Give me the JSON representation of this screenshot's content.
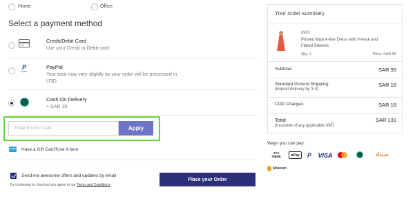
{
  "address_types": {
    "home": "Home",
    "office": "Office"
  },
  "section_title": "Select a payment method",
  "payment_methods": [
    {
      "title": "Credit/Debit Card",
      "subtitle": "Use your Credit or Debit card"
    },
    {
      "title": "PayPal",
      "subtitle_line1": "Your total may vary slightly as your order will be processed in",
      "subtitle_line2": "USD."
    },
    {
      "title": "Cash On Delivery",
      "subtitle": "+ SAR 18"
    }
  ],
  "promo": {
    "placeholder": "Enter Promo Code",
    "apply_label": "Apply"
  },
  "gift_card": {
    "text": "Have a Gift Card?",
    "link": "Use it here"
  },
  "newsletter": {
    "label": "Send me awesome offers and updates by email"
  },
  "terms": {
    "prefix": "By continuing to checkout you agree to our",
    "link": "Terms and Conditions"
  },
  "place_order_label": "Place your Order",
  "summary": {
    "title": "Your order summary",
    "item": {
      "brand": "MAX",
      "name_line1": "Printed Maxi A-line Dress with V-neck and",
      "name_line2": "Flared Sleeves",
      "qty": "Qty: 1",
      "price": "Price: SAR 95"
    },
    "subtotal_label": "Subtotal:",
    "subtotal_value": "SAR 95",
    "shipping_label": "Standard Ground Shipping:",
    "shipping_note": "(Expect delivery by 3-4)",
    "shipping_value": "SAR 18",
    "cod_label": "COD Charges:",
    "cod_value": "SAR 18",
    "total_label": "Total",
    "total_note": "(Inclusive of any applicable VAT)",
    "total_value": "SAR 131"
  },
  "ways_to_pay": {
    "title": "Ways you can pay:",
    "logos": {
      "mada_ar": "مدى",
      "mada": "mada",
      "apple_pay": "Pay",
      "paypal": "P",
      "visa": "VISA",
      "cod_ar": "ﺳـﺪﺍﺩ",
      "shukran": "Shukran"
    }
  },
  "colors": {
    "accent": "#2c2f7a",
    "apply": "#6f74c9",
    "highlight": "#5ed43c"
  }
}
